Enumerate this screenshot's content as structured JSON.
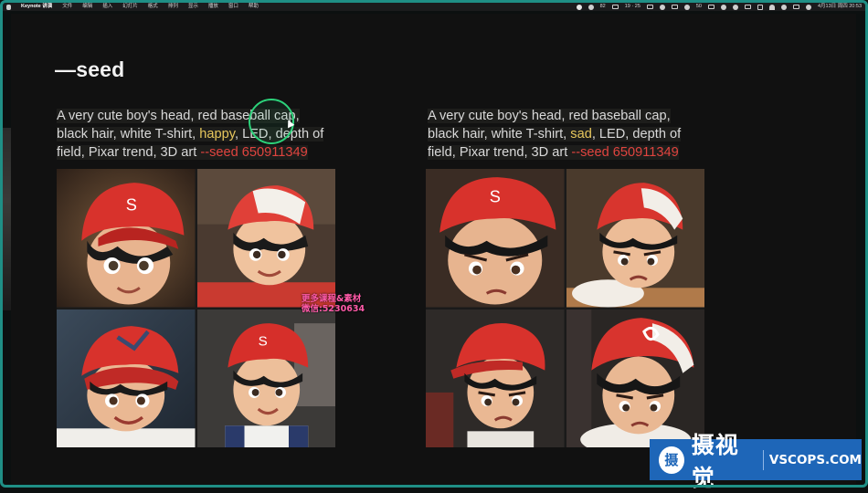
{
  "menubar": {
    "app_name": "Keynote 讲演",
    "menus": [
      "文件",
      "编辑",
      "插入",
      "幻灯片",
      "格式",
      "排列",
      "显示",
      "播放",
      "窗口",
      "帮助"
    ],
    "status": {
      "battery_a": "82",
      "time_range": "19 · 25",
      "badge": "50",
      "date_time": "4月13日 周四 20:53"
    }
  },
  "slide": {
    "title": "—seed",
    "left_prompt": {
      "line1": "A very cute boy's head, red baseball cap,",
      "line2_a": "black hair, white T-shirt, ",
      "line2_mood": "happy",
      "line2_b": ", LED, depth of",
      "line3_a": "field, Pixar trend, 3D art ",
      "line3_seed": "--seed 650911349"
    },
    "right_prompt": {
      "line1": "A very cute boy's head, red baseball cap,",
      "line2_a": "black hair, white T-shirt, ",
      "line2_mood": "sad",
      "line2_b": ", LED, depth of",
      "line3_a": "field, Pixar trend, 3D art ",
      "line3_seed": "--seed 650911349"
    }
  },
  "overlay": {
    "line1": "更多课程&素材",
    "line2": "微信:5230634"
  },
  "watermark": {
    "logo_char": "摄",
    "cn": "摄视觉",
    "en": "VSCOPS.COM"
  },
  "colors": {
    "mood_highlight": "#e8c75d",
    "seed_highlight": "#e0443f",
    "frame": "#1f8f86",
    "cursor_ring": "#2cd27a"
  }
}
